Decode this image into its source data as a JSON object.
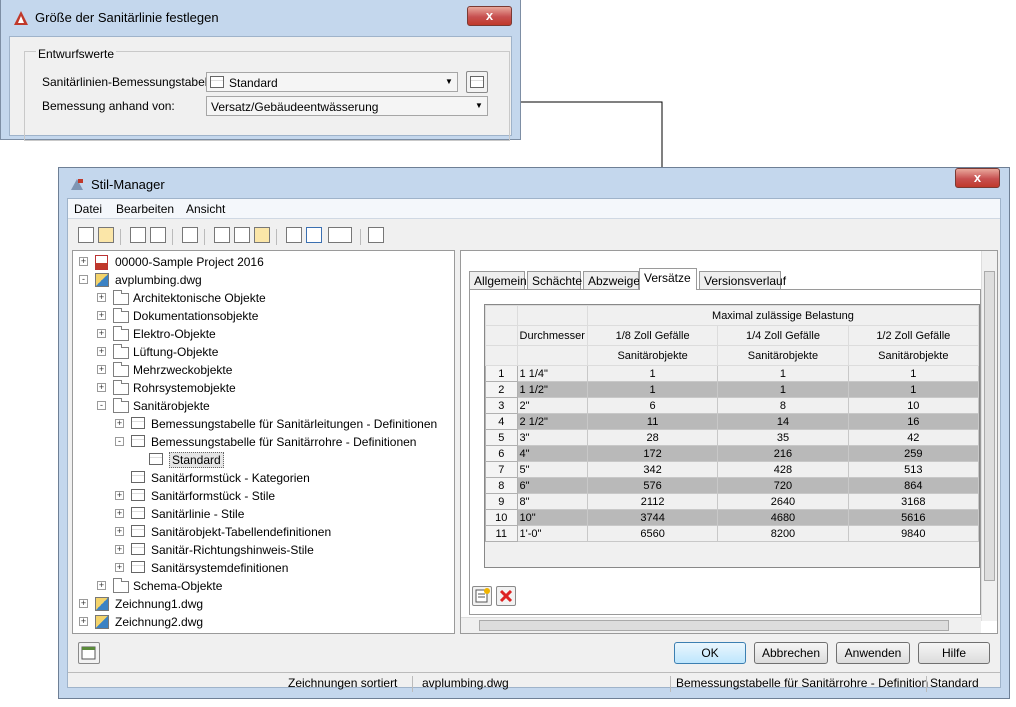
{
  "dialog1": {
    "title": "Größe der Sanitärlinie festlegen",
    "close": "x",
    "group_label": "Entwurfswerte",
    "table_label": "Sanitärlinien-Bemessungstabelle:",
    "table_value": "Standard",
    "basis_label": "Bemessung anhand von:",
    "basis_value": "Versatz/Gebäudeentwässerung"
  },
  "manager": {
    "title": "Stil-Manager",
    "close": "x",
    "menu": [
      "Datei",
      "Bearbeiten",
      "Ansicht"
    ],
    "tree": [
      {
        "label": "00000-Sample Project 2016",
        "level": 0,
        "icon": "project-icon",
        "exp": "+"
      },
      {
        "label": "avplumbing.dwg",
        "level": 0,
        "icon": "drawing-icon",
        "exp": "-"
      },
      {
        "label": "Architektonische Objekte",
        "level": 1,
        "icon": "folder-icon",
        "exp": "+"
      },
      {
        "label": "Dokumentationsobjekte",
        "level": 1,
        "icon": "folder-icon",
        "exp": "+"
      },
      {
        "label": "Elektro-Objekte",
        "level": 1,
        "icon": "folder-icon",
        "exp": "+"
      },
      {
        "label": "Lüftung-Objekte",
        "level": 1,
        "icon": "folder-icon",
        "exp": "+"
      },
      {
        "label": "Mehrzweckobjekte",
        "level": 1,
        "icon": "folder-icon",
        "exp": "+"
      },
      {
        "label": "Rohrsystemobjekte",
        "level": 1,
        "icon": "folder-icon",
        "exp": "+"
      },
      {
        "label": "Sanitärobjekte",
        "level": 1,
        "icon": "folder-icon",
        "exp": "-"
      },
      {
        "label": "Bemessungstabelle für Sanitärleitungen - Definitionen",
        "level": 2,
        "icon": "table-icon",
        "exp": "+"
      },
      {
        "label": "Bemessungstabelle für Sanitärrohre - Definitionen",
        "level": 2,
        "icon": "table-icon",
        "exp": "-"
      },
      {
        "label": "Standard",
        "level": 3,
        "icon": "table-icon",
        "exp": "",
        "selected": true
      },
      {
        "label": "Sanitärformstück - Kategorien",
        "level": 2,
        "icon": "category-icon",
        "exp": ""
      },
      {
        "label": "Sanitärformstück - Stile",
        "level": 2,
        "icon": "fitting-icon",
        "exp": "+"
      },
      {
        "label": "Sanitärlinie - Stile",
        "level": 2,
        "icon": "line-icon",
        "exp": "+"
      },
      {
        "label": "Sanitärobjekt-Tabellendefinitionen",
        "level": 2,
        "icon": "table-icon",
        "exp": "+"
      },
      {
        "label": "Sanitär-Richtungshinweis-Stile",
        "level": 2,
        "icon": "direction-icon",
        "exp": "+"
      },
      {
        "label": "Sanitärsystemdefinitionen",
        "level": 2,
        "icon": "system-icon",
        "exp": "+"
      },
      {
        "label": "Schema-Objekte",
        "level": 1,
        "icon": "folder-icon",
        "exp": "+"
      },
      {
        "label": "Zeichnung1.dwg",
        "level": 0,
        "icon": "drawing-icon",
        "exp": "+"
      },
      {
        "label": "Zeichnung2.dwg",
        "level": 0,
        "icon": "drawing-icon",
        "exp": "+"
      }
    ],
    "tabs": [
      "Allgemein",
      "Schächte",
      "Abzweige",
      "Versätze",
      "Versionsverlauf"
    ],
    "active_tab": "Versätze",
    "table": {
      "col_header": "Durchmesser",
      "group_header": "Maximal zulässige Belastung",
      "sub_headers": [
        "1/8 Zoll Gefälle",
        "1/4 Zoll Gefälle",
        "1/2 Zoll Gefälle"
      ],
      "unit_headers": [
        "Sanitärobjekte",
        "Sanitärobjekte",
        "Sanitärobjekte"
      ],
      "rows": [
        [
          "1",
          "1 1/4\"",
          "1",
          "1",
          "1"
        ],
        [
          "2",
          "1 1/2\"",
          "1",
          "1",
          "1"
        ],
        [
          "3",
          "2\"",
          "6",
          "8",
          "10"
        ],
        [
          "4",
          "2 1/2\"",
          "11",
          "14",
          "16"
        ],
        [
          "5",
          "3\"",
          "28",
          "35",
          "42"
        ],
        [
          "6",
          "4\"",
          "172",
          "216",
          "259"
        ],
        [
          "7",
          "5\"",
          "342",
          "428",
          "513"
        ],
        [
          "8",
          "6\"",
          "576",
          "720",
          "864"
        ],
        [
          "9",
          "8\"",
          "2112",
          "2640",
          "3168"
        ],
        [
          "10",
          "10\"",
          "3744",
          "4680",
          "5616"
        ],
        [
          "11",
          "1'-0\"",
          "6560",
          "8200",
          "9840"
        ]
      ]
    },
    "buttons": {
      "ok": "OK",
      "cancel": "Abbrechen",
      "apply": "Anwenden",
      "help": "Hilfe"
    },
    "status": {
      "s1": "Zeichnungen sortiert",
      "s2": "avplumbing.dwg",
      "s3": "Bemessungstabelle für Sanitärrohre - Definition",
      "s4": "Standard"
    }
  }
}
